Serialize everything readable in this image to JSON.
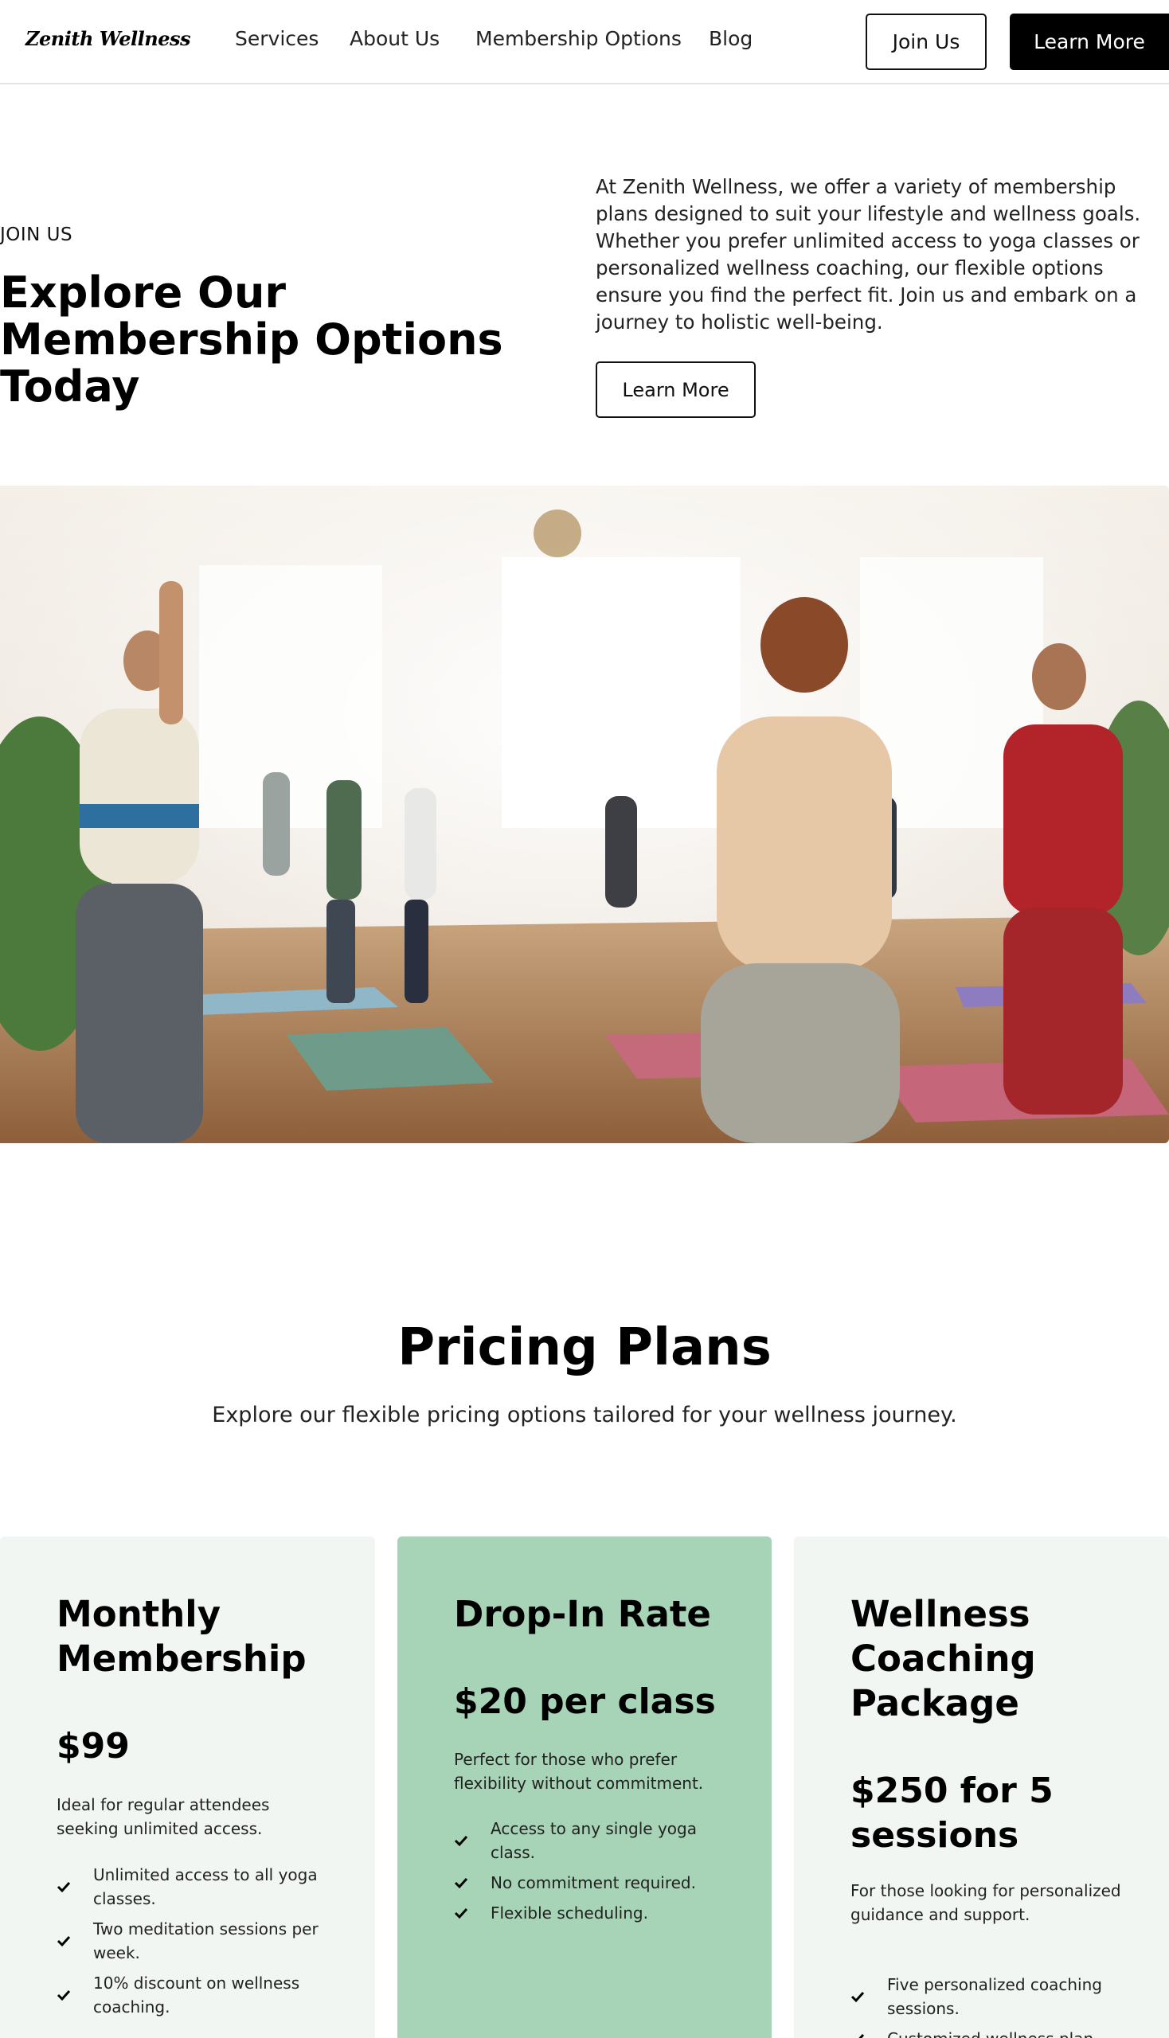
{
  "brand": {
    "logo_text": "Zenith Wellness"
  },
  "nav": {
    "links": [
      "Services",
      "About Us",
      "Membership Options",
      "Blog"
    ],
    "join_label": "Join Us",
    "learn_label": "Learn More"
  },
  "hero": {
    "eyebrow": "JOIN US",
    "title": "Explore Our Membership Options Today",
    "description": "At Zenith Wellness, we offer a variety of membership plans designed to suit your lifestyle and wellness goals. Whether you prefer unlimited access to yoga classes or personalized wellness coaching, our flexible options ensure you find the perfect fit. Join us and embark on a journey to holistic well-being.",
    "button_label": "Learn More",
    "image_icon": "yoga-class-photo"
  },
  "pricing": {
    "title": "Pricing Plans",
    "subtitle": "Explore our flexible pricing options tailored for your wellness journey.",
    "plans": [
      {
        "title": "Monthly Membership",
        "price": "$99",
        "description": "Ideal for regular attendees seeking unlimited access.",
        "features": [
          "Unlimited access to all yoga classes.",
          "Two meditation sessions per week.",
          "10% discount on wellness coaching."
        ],
        "background": "#f2f6f3"
      },
      {
        "title": "Drop-In Rate",
        "price": "$20 per class",
        "description": "Perfect for those who prefer flexibility without commitment.",
        "features": [
          "Access to any single yoga class.",
          "No commitment required.",
          "Flexible scheduling."
        ],
        "background": "#a7d3b7"
      },
      {
        "title": "Wellness Coaching Package",
        "price": "$250 for 5 sessions",
        "description": "For those looking for personalized guidance and support.",
        "features": [
          "Five personalized coaching sessions.",
          "Customized wellness plan."
        ],
        "background": "#f2f6f3"
      }
    ]
  },
  "icons": {
    "feature_check": "check-icon"
  },
  "colors": {
    "accent_green": "#a7d3b7",
    "card_light": "#f2f6f3",
    "primary": "#000000"
  }
}
